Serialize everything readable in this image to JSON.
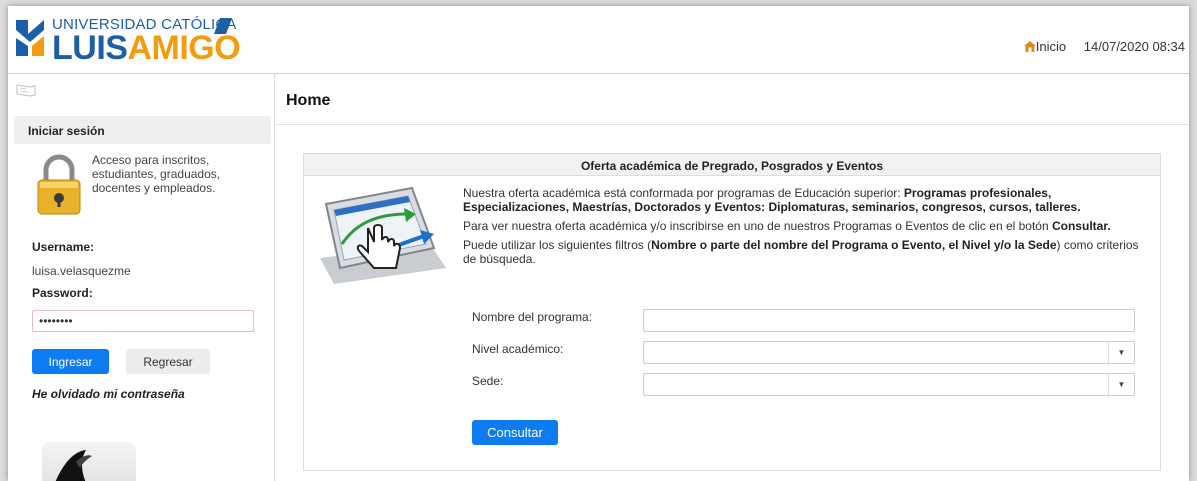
{
  "header": {
    "logo_line1": "UNIVERSIDAD CATÓLICA",
    "logo_line2_part1": "LUIS",
    "logo_line2_part2": "AMIGO",
    "home_link": "Inicio",
    "datetime": "14/07/2020 08:34",
    "colors": {
      "brand_blue": "#1c5fa8",
      "brand_orange": "#f39c12"
    }
  },
  "sidebar": {
    "login_title": "Iniciar sesión",
    "description": "Acceso para inscritos, estudiantes, graduados, docentes y empleados.",
    "username_label": "Username:",
    "username_value": "luisa.velasquezme",
    "password_label": "Password:",
    "password_value": "••••••••",
    "login_button": "Ingresar",
    "back_button": "Regresar",
    "forgot_link": "He olvidado mi contraseña"
  },
  "main": {
    "page_title": "Home",
    "panel_title": "Oferta académica de Pregrado, Posgrados y Eventos",
    "para1_text": "Nuestra oferta académica está conformada por programas de Educación superior: ",
    "para1_bold": "Programas profesionales, Especializaciones, Maestrías, Doctorados y Eventos: Diplomaturas, seminarios, congresos, cursos, talleres.",
    "para2_text": "Para ver nuestra oferta académica y/o inscribirse en uno de nuestros Programas o Eventos de clic en el botón ",
    "para2_bold": "Consultar.",
    "para3_text_a": "Puede utilizar los siguientes filtros (",
    "para3_bold": "Nombre o parte del nombre del Programa o Evento, el Nivel y/o la Sede",
    "para3_text_b": ") como criterios de búsqueda.",
    "filters": {
      "program_label": "Nombre del programa:",
      "program_value": "",
      "level_label": "Nivel académico:",
      "level_value": "",
      "campus_label": "Sede:",
      "campus_value": ""
    },
    "submit_button": "Consultar",
    "colors": {
      "primary_button": "#0d7cf2"
    }
  }
}
